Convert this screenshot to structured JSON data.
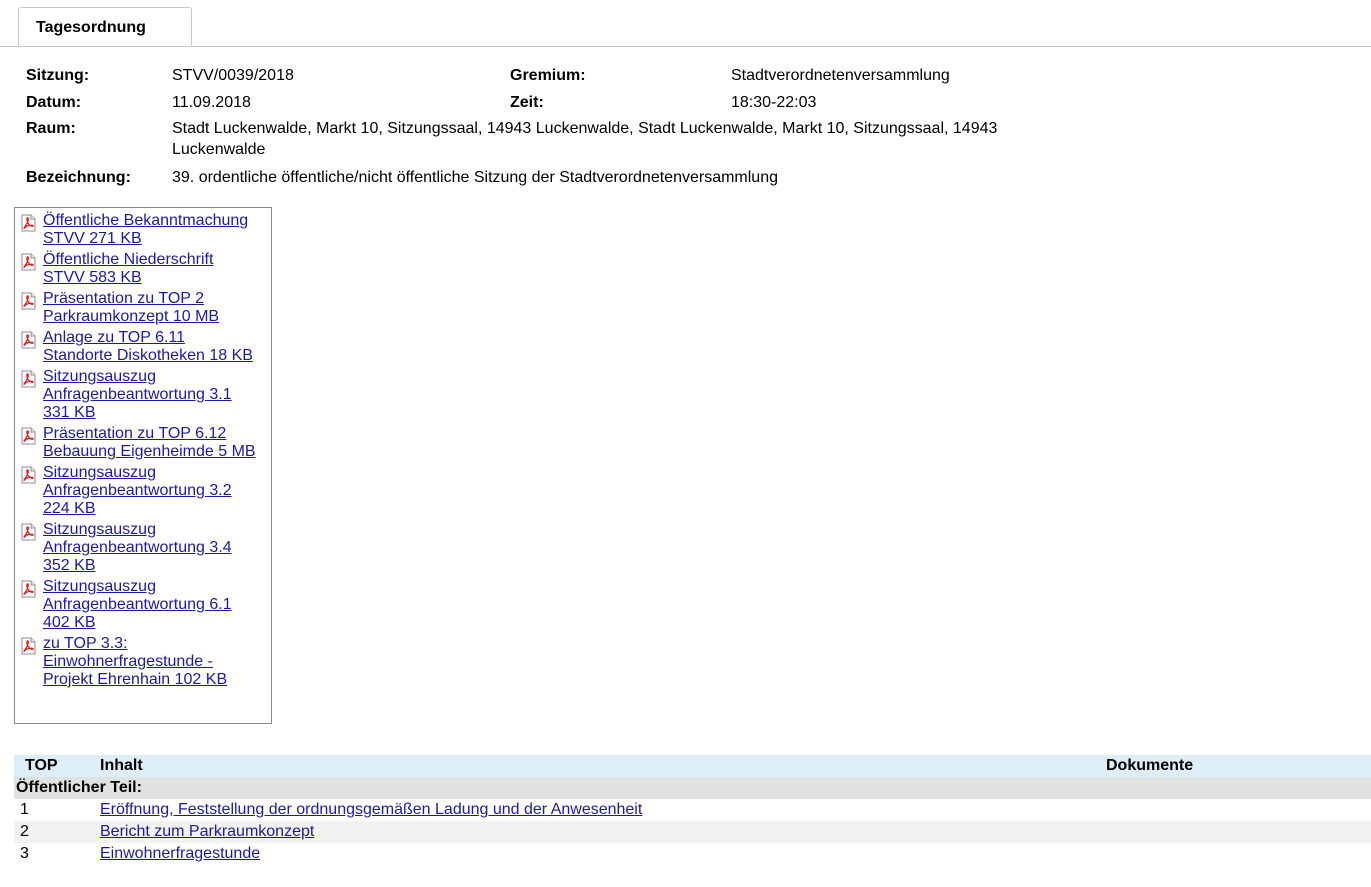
{
  "tab": {
    "label": "Tagesordnung"
  },
  "meeting": {
    "sitzung_label": "Sitzung:",
    "sitzung": "STVV/0039/2018",
    "gremium_label": "Gremium:",
    "gremium": "Stadtverordnetenversammlung",
    "datum_label": "Datum:",
    "datum": "11.09.2018",
    "zeit_label": "Zeit:",
    "zeit": "18:30-22:03",
    "raum_label": "Raum:",
    "raum_line1": "Stadt Luckenwalde, Markt 10, Sitzungssaal, 14943 Luckenwalde, Stadt Luckenwalde, Markt 10, Sitzungssaal, 14943",
    "raum_line2": "Luckenwalde",
    "bezeichnung_label": "Bezeichnung:",
    "bezeichnung": "39. ordentliche öffentliche/nicht öffentliche Sitzung der Stadtverordnetenversammlung"
  },
  "documents": [
    {
      "lines": [
        "Öffentliche Bekanntmachung",
        "STVV 271 KB"
      ],
      "icon": "pdf-icon"
    },
    {
      "lines": [
        "Öffentliche Niederschrift",
        "STVV 583 KB"
      ],
      "icon": "pdf-icon"
    },
    {
      "lines": [
        "Präsentation zu TOP 2",
        "Parkraumkonzept 10 MB"
      ],
      "icon": "pdf-icon"
    },
    {
      "lines": [
        "Anlage zu TOP 6.11",
        "Standorte Diskotheken 18 KB"
      ],
      "icon": "pdf-icon"
    },
    {
      "lines": [
        "Sitzungsauszug",
        "Anfragenbeantwortung 3.1",
        "331 KB"
      ],
      "icon": "pdf-icon"
    },
    {
      "lines": [
        "Präsentation zu TOP 6.12",
        "Bebauung Eigenheimde 5 MB"
      ],
      "icon": "pdf-icon"
    },
    {
      "lines": [
        "Sitzungsauszug",
        "Anfragenbeantwortung 3.2",
        "224 KB"
      ],
      "icon": "pdf-icon"
    },
    {
      "lines": [
        "Sitzungsauszug",
        "Anfragenbeantwortung 3.4",
        "352 KB"
      ],
      "icon": "pdf-icon"
    },
    {
      "lines": [
        "Sitzungsauszug",
        "Anfragenbeantwortung 6.1",
        "402 KB"
      ],
      "icon": "pdf-icon"
    },
    {
      "lines": [
        "zu TOP 3.3:",
        "Einwohnerfragestunde -",
        "Projekt Ehrenhain 102 KB"
      ],
      "icon": "pdf-icon"
    }
  ],
  "agenda": {
    "headers": {
      "top": "TOP",
      "inhalt": "Inhalt",
      "dokumente": "Dokumente"
    },
    "section": "Öffentlicher Teil:",
    "rows": [
      {
        "top": "1",
        "inhalt": "Eröffnung, Feststellung der ordnungsgemäßen Ladung und der Anwesenheit"
      },
      {
        "top": "2",
        "inhalt": "Bericht zum Parkraumkonzept"
      },
      {
        "top": "3",
        "inhalt": "Einwohnerfragestunde"
      }
    ]
  },
  "colors": {
    "link": "#1a1aa8",
    "header_bg": "#ddeef9",
    "section_bg": "#e1e1e1",
    "stripe_bg": "#f2f2f2"
  }
}
